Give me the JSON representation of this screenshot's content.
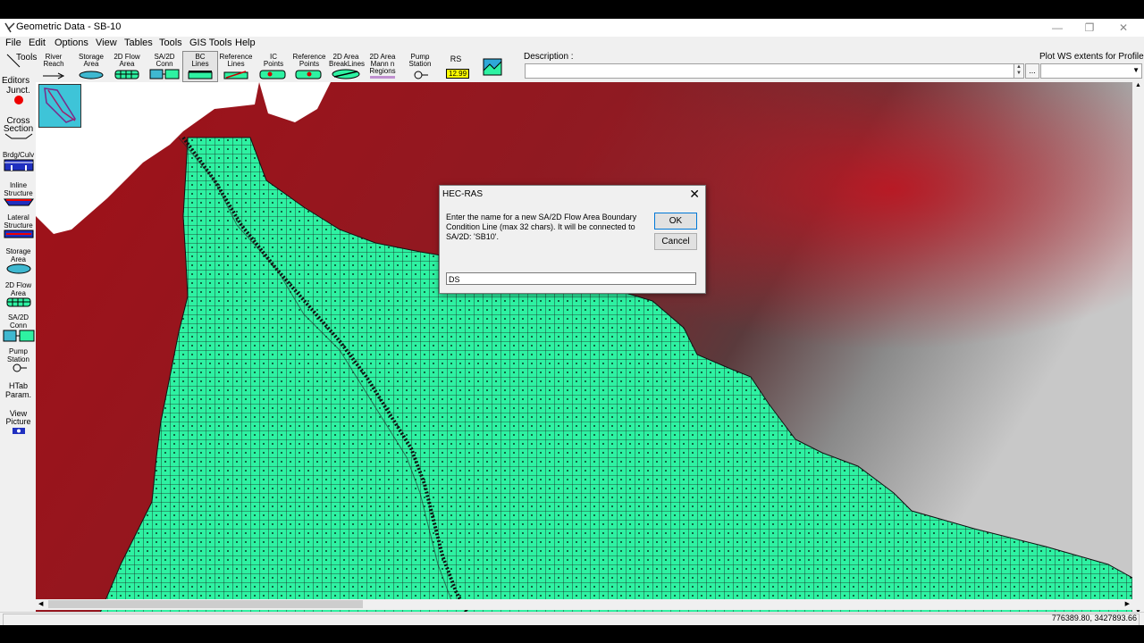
{
  "window": {
    "title": "Geometric Data - SB-10"
  },
  "menu": [
    "File",
    "Edit",
    "Options",
    "View",
    "Tables",
    "Tools",
    "GIS Tools",
    "Help"
  ],
  "toolbar": {
    "tools_label": "Tools",
    "buttons": [
      {
        "label": "River\nReach"
      },
      {
        "label": "Storage\nArea"
      },
      {
        "label": "2D Flow\nArea"
      },
      {
        "label": "SA/2D\nConn"
      },
      {
        "label": "BC\nLines"
      },
      {
        "label": "Reference\nLines"
      },
      {
        "label": "IC\nPoints"
      },
      {
        "label": "Reference\nPoints"
      },
      {
        "label": "2D Area\nBreakLines"
      },
      {
        "label": "2D Area\nMann n\nRegions"
      },
      {
        "label": "Pump\nStation"
      },
      {
        "label": "RS",
        "value": "12.99"
      }
    ],
    "description_label": "Description :",
    "plot_ws_label": "Plot WS extents for Profile:",
    "ellipsis": "..."
  },
  "sidebar": {
    "editors_label": "Editors",
    "items": [
      {
        "label": "Junct."
      },
      {
        "label": "Cross\nSection"
      },
      {
        "label": "Brdg/Culv"
      },
      {
        "label": "Inline\nStructure"
      },
      {
        "label": "Lateral\nStructure"
      },
      {
        "label": "Storage\nArea"
      },
      {
        "label": "2D Flow\nArea"
      },
      {
        "label": "SA/2D\nConn"
      },
      {
        "label": "Pump\nStation"
      },
      {
        "label": "HTab\nParam."
      },
      {
        "label": "View\nPicture"
      }
    ]
  },
  "dialog": {
    "title": "HEC-RAS",
    "message": "Enter the name for a new SA/2D Flow Area Boundary Condition Line (max 32 chars). It will be connected to SA/2D: 'SB10'.",
    "ok_label": "OK",
    "cancel_label": "Cancel",
    "input_value": "DS"
  },
  "status": {
    "coordinates": "776389.80, 3427893.66"
  },
  "colors": {
    "mesh": "#2ef2a2",
    "terrain_high": "#b0121d",
    "terrain_low": "#bdbdbd",
    "background": "#ffffff"
  }
}
